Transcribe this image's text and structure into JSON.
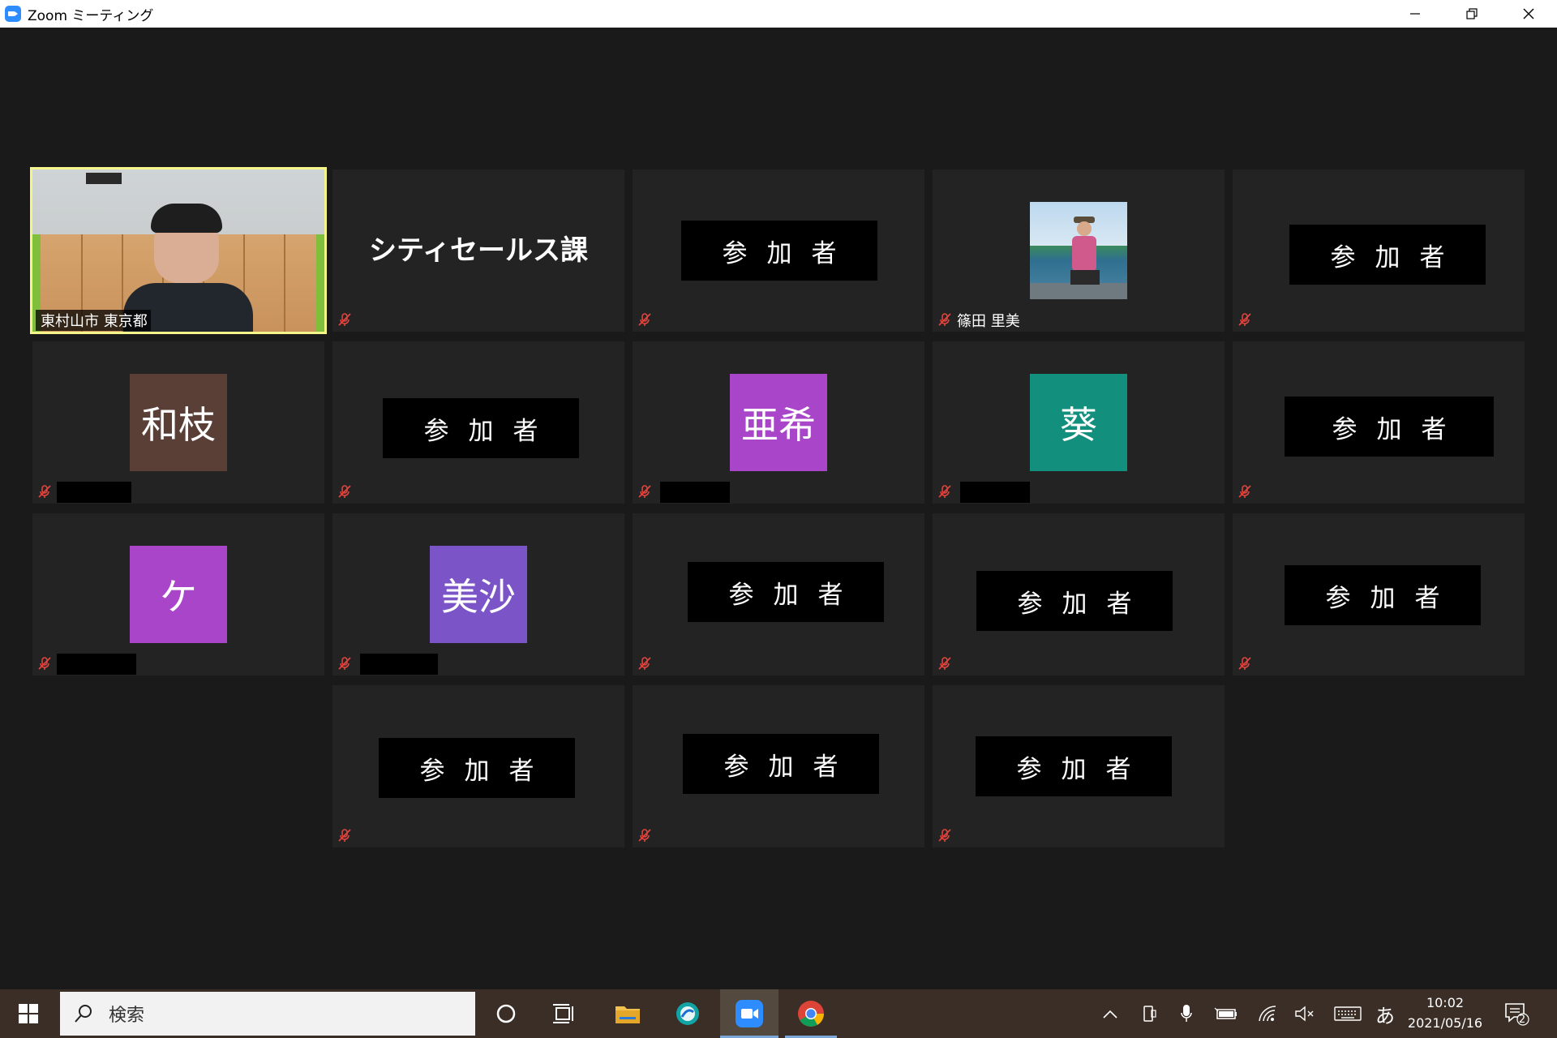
{
  "window": {
    "title": "Zoom ミーティング",
    "controls": [
      "minimize-icon",
      "restore-icon",
      "close-icon"
    ]
  },
  "tiles": {
    "t1": {
      "name": "東村山市 東京都",
      "type": "video"
    },
    "t2": {
      "text": "シティセールス課"
    },
    "t3": {
      "label": "参加者"
    },
    "t4": {
      "name": "篠田 里美",
      "type": "photo"
    },
    "t5": {
      "label": "参加者"
    },
    "t6": {
      "initials": "和枝",
      "color": "#5a3f36"
    },
    "t7": {
      "label": "参加者"
    },
    "t8": {
      "initials": "亜希",
      "color": "#a845c8"
    },
    "t9": {
      "initials": "葵",
      "color": "#128f7d"
    },
    "t10": {
      "label": "参加者"
    },
    "t11": {
      "initials": "ケ",
      "color": "#a845c8"
    },
    "t12": {
      "initials": "美沙",
      "color": "#7b55c7"
    },
    "t13": {
      "label": "参加者"
    },
    "t14": {
      "label": "参加者"
    },
    "t15": {
      "label": "参加者"
    },
    "t16": {
      "label": "参加者"
    },
    "t17": {
      "label": "参加者"
    },
    "t18": {
      "label": "参加者"
    }
  },
  "taskbar": {
    "search_placeholder": "検索",
    "ime": "あ",
    "time": "10:02",
    "date": "2021/05/16",
    "notification_count": "2"
  },
  "colors": {
    "active_speaker_border": "#f5f58a",
    "mute_icon": "#e0443e",
    "zoom_blue": "#2d8cff"
  }
}
